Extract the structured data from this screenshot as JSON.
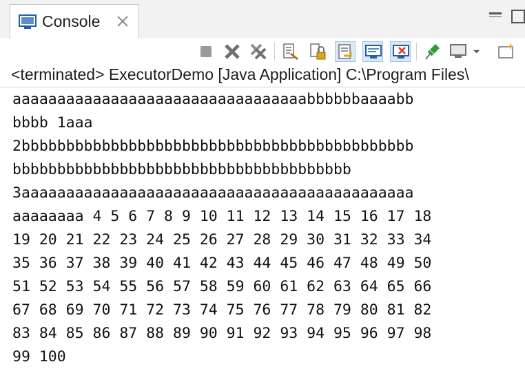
{
  "tab": {
    "label": "Console",
    "icon": "console-icon"
  },
  "status": {
    "text": "<terminated> ExecutorDemo [Java Application] C:\\Program Files\\"
  },
  "toolbar": {
    "items": [
      "terminate",
      "remove-launch",
      "remove-all-terminated",
      "clear-console",
      "scroll-lock",
      "word-wrap",
      "show-on-stdout",
      "show-on-stderr",
      "pin-console",
      "display-selected-console",
      "open-console"
    ]
  },
  "console": {
    "lines": [
      "aaaaaaaaaaaaaaaaaaaaaaaaaaaaaaaaabbbbbbaaaabb",
      "bbbb 1aaa",
      "2bbbbbbbbbbbbbbbbbbbbbbbbbbbbbbbbbbbbbbbbbbbb",
      "bbbbbbbbbbbbbbbbbbbbbbbbbbbbbbbbbbbbbb",
      "3aaaaaaaaaaaaaaaaaaaaaaaaaaaaaaaaaaaaaaaaaaaa",
      "aaaaaaaa 4 5 6 7 8 9 10 11 12 13 14 15 16 17 18",
      "19 20 21 22 23 24 25 26 27 28 29 30 31 32 33 34",
      "35 36 37 38 39 40 41 42 43 44 45 46 47 48 49 50",
      "51 52 53 54 55 56 57 58 59 60 61 62 63 64 65 66",
      "67 68 69 70 71 72 73 74 75 76 77 78 79 80 81 82",
      "83 84 85 86 87 88 89 90 91 92 93 94 95 96 97 98",
      "99 100"
    ]
  },
  "colors": {
    "tab_icon": "#1f5fa8",
    "terminate_red": "#d9342b",
    "pin_green": "#2e9a3a"
  }
}
